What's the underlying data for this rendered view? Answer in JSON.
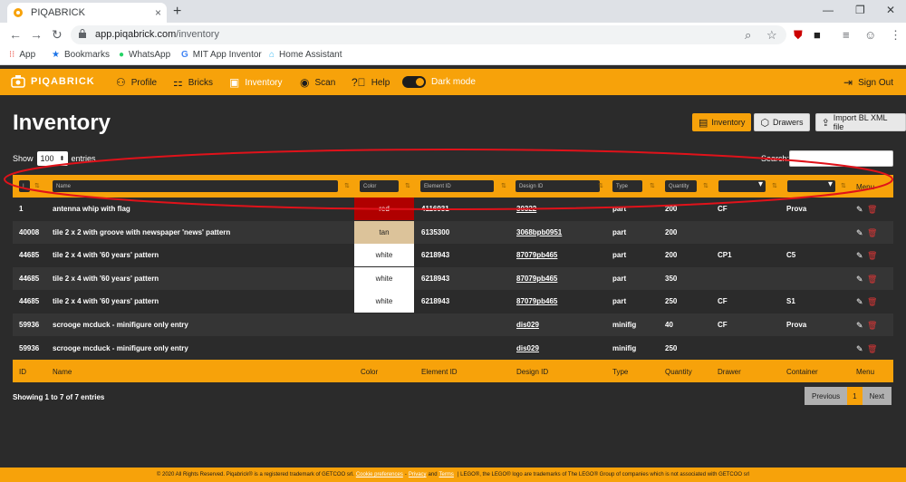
{
  "browser": {
    "tab_title": "PIQABRICK",
    "tab_close": "×",
    "new_tab": "+",
    "url_host": "app.piqabrick.com",
    "url_path": "/inventory",
    "bookmarks": [
      {
        "label": "App",
        "icon": "apps-grid-icon"
      },
      {
        "label": "Bookmarks",
        "icon": "star-icon"
      },
      {
        "label": "WhatsApp",
        "icon": "whatsapp-icon"
      },
      {
        "label": "MIT App Inventor",
        "icon": "google-icon"
      },
      {
        "label": "Home Assistant",
        "icon": "home-assistant-icon"
      }
    ]
  },
  "app": {
    "brand": "PIQABRICK",
    "nav": [
      {
        "label": "Profile",
        "icon": "user-icon"
      },
      {
        "label": "Bricks",
        "icon": "bricks-icon"
      },
      {
        "label": "Inventory",
        "icon": "inventory-icon"
      },
      {
        "label": "Scan",
        "icon": "eye-icon"
      },
      {
        "label": "Help",
        "icon": "help-icon"
      }
    ],
    "dark_mode_label": "Dark mode",
    "dark_mode_on": true,
    "sign_out": "Sign Out",
    "accent": "#f7a20a"
  },
  "page": {
    "title": "Inventory",
    "buttons": [
      {
        "label": "Inventory",
        "icon": "archive-icon"
      },
      {
        "label": "Drawers",
        "icon": "cube-icon"
      },
      {
        "label": "Import BL XML file",
        "icon": "upload-icon"
      }
    ],
    "show_label": "Show",
    "entries_value": "100",
    "entries_label": "entries",
    "search_label": "Search:"
  },
  "table": {
    "filter_placeholders": {
      "id": "I",
      "name": "Name",
      "color": "Color",
      "element_id": "Element ID",
      "design_id": "Design ID",
      "type": "Type",
      "quantity": "Quantity"
    },
    "menu_header": "Menu",
    "columns": [
      "ID",
      "Name",
      "Color",
      "Element ID",
      "Design ID",
      "Type",
      "Quantity",
      "Drawer",
      "Container",
      "Menu"
    ],
    "rows": [
      {
        "id": "1",
        "name": "antenna whip with flag",
        "color": "red",
        "color_bg": "#b00000",
        "color_fg": "#ffffff",
        "element_id": "4116931",
        "design_id": "30322",
        "type": "part",
        "quantity": "200",
        "drawer": "CF",
        "container": "Prova"
      },
      {
        "id": "40008",
        "name": "tile 2 x 2 with groove with newspaper 'news' pattern",
        "color": "tan",
        "color_bg": "#dcc39a",
        "color_fg": "#1d1d1d",
        "element_id": "6135300",
        "design_id": "3068bpb0951",
        "type": "part",
        "quantity": "200",
        "drawer": "",
        "container": ""
      },
      {
        "id": "44685",
        "name": "tile 2 x 4 with '60 years' pattern",
        "color": "white",
        "color_bg": "#ffffff",
        "color_fg": "#1d1d1d",
        "element_id": "6218943",
        "design_id": "87079pb465",
        "type": "part",
        "quantity": "200",
        "drawer": "CP1",
        "container": "C5"
      },
      {
        "id": "44685",
        "name": "tile 2 x 4 with '60 years' pattern",
        "color": "white",
        "color_bg": "#ffffff",
        "color_fg": "#1d1d1d",
        "element_id": "6218943",
        "design_id": "87079pb465",
        "type": "part",
        "quantity": "350",
        "drawer": "",
        "container": ""
      },
      {
        "id": "44685",
        "name": "tile 2 x 4 with '60 years' pattern",
        "color": "white",
        "color_bg": "#ffffff",
        "color_fg": "#1d1d1d",
        "element_id": "6218943",
        "design_id": "87079pb465",
        "type": "part",
        "quantity": "250",
        "drawer": "CF",
        "container": "S1"
      },
      {
        "id": "59936",
        "name": "scrooge mcduck - minifigure only entry",
        "color": "",
        "color_bg": "",
        "color_fg": "",
        "element_id": "",
        "design_id": "dis029",
        "type": "minifig",
        "quantity": "40",
        "drawer": "CF",
        "container": "Prova"
      },
      {
        "id": "59936",
        "name": "scrooge mcduck - minifigure only entry",
        "color": "",
        "color_bg": "",
        "color_fg": "",
        "element_id": "",
        "design_id": "dis029",
        "type": "minifig",
        "quantity": "250",
        "drawer": "",
        "container": ""
      }
    ],
    "showing": "Showing 1 to 7 of 7 entries",
    "pager": {
      "previous": "Previous",
      "current": "1",
      "next": "Next"
    }
  },
  "footer": {
    "prefix": "© 2020 All Rights Reserved. Piqabrick® is a registered trademark of GETCOO srl.",
    "cookie": "Cookie preferences",
    "sep": "-",
    "privacy": "Privacy",
    "and": "and",
    "terms": "Terms",
    "suffix": "| LEGO®, the LEGO® logo are trademarks of The LEGO® Group of companies which is not associated with GETCOO srl"
  }
}
